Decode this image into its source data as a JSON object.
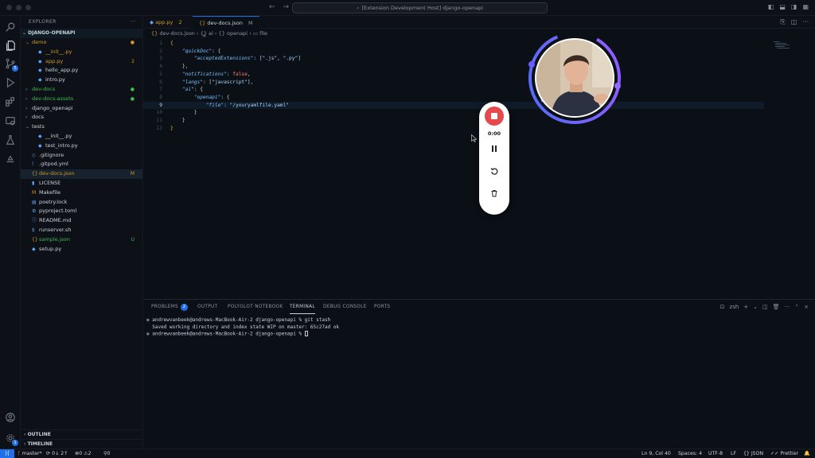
{
  "titlebar": {
    "command_center": "[Extension Development Host] django-openapi"
  },
  "activity_bar": {
    "source_control_badge": "5",
    "accounts_badge": "1"
  },
  "sidebar": {
    "header": "EXPLORER",
    "root": "DJANGO-OPENAPI",
    "items": [
      {
        "label": "demo",
        "status": "",
        "kind": "folder"
      },
      {
        "label": "__init__.py",
        "status": "",
        "kind": "file"
      },
      {
        "label": "app.py",
        "status": "2",
        "kind": "file"
      },
      {
        "label": "hello_app.py",
        "status": "",
        "kind": "file"
      },
      {
        "label": "intro.py",
        "status": "",
        "kind": "file"
      },
      {
        "label": "dev-docs",
        "status": "",
        "kind": "folder"
      },
      {
        "label": "dev-docs-assets",
        "status": "",
        "kind": "folder"
      },
      {
        "label": "django_openapi",
        "status": "",
        "kind": "folder"
      },
      {
        "label": "docs",
        "status": "",
        "kind": "folder"
      },
      {
        "label": "tests",
        "status": "",
        "kind": "folder"
      },
      {
        "label": "__init__.py",
        "status": "",
        "kind": "file"
      },
      {
        "label": "test_intro.py",
        "status": "",
        "kind": "file"
      },
      {
        "label": ".gitignore",
        "status": "",
        "kind": "file"
      },
      {
        "label": ".gitpod.yml",
        "status": "",
        "kind": "file"
      },
      {
        "label": "dev-docs.json",
        "status": "M",
        "kind": "file"
      },
      {
        "label": "LICENSE",
        "status": "",
        "kind": "file"
      },
      {
        "label": "Makefile",
        "status": "",
        "kind": "file"
      },
      {
        "label": "poetry.lock",
        "status": "",
        "kind": "file"
      },
      {
        "label": "pyproject.toml",
        "status": "",
        "kind": "file"
      },
      {
        "label": "README.md",
        "status": "",
        "kind": "file"
      },
      {
        "label": "runserver.sh",
        "status": "",
        "kind": "file"
      },
      {
        "label": "sample.json",
        "status": "U",
        "kind": "file"
      },
      {
        "label": "setup.py",
        "status": "",
        "kind": "file"
      }
    ],
    "outline": "OUTLINE",
    "timeline": "TIMELINE"
  },
  "tabs": [
    {
      "label": "app.py",
      "badge": "2"
    },
    {
      "label": "dev-docs.json",
      "badge": "M"
    }
  ],
  "breadcrumb": {
    "file": "dev-docs.json",
    "seg1": "ai",
    "seg2": "openapi",
    "seg3": "file"
  },
  "code": {
    "line_numbers": [
      "1",
      "2",
      "3",
      "4",
      "5",
      "6",
      "7",
      "8",
      "9",
      "10",
      "11",
      "12"
    ],
    "l1": "{",
    "l2_key": "\"quickDoc\"",
    "l3_key": "\"acceptedExtensions\"",
    "l3_v1": "\".js\"",
    "l3_v2": "\".py\"",
    "l4": "},",
    "l5_key": "\"notifications\"",
    "l5_val": "false",
    "l6_key": "\"langs\"",
    "l6_val": "\"javascript\"",
    "l7_key": "\"ai\"",
    "l8_key": "\"openapi\"",
    "l9_key": "\"file\"",
    "l9_val": "\"/youryamlfile.yaml\"",
    "l10": "}",
    "l11": "}",
    "l12": "}"
  },
  "recorder": {
    "time": "0:00"
  },
  "panel": {
    "tabs": [
      "PROBLEMS",
      "OUTPUT",
      "POLYGLOT NOTEBOOK",
      "TERMINAL",
      "DEBUG CONSOLE",
      "PORTS"
    ],
    "problems_count": "2",
    "shell": "zsh",
    "terminal": [
      "andrewvanbeek@andrews-MacBook-Air-2 django-openapi % git stash",
      "Saved working directory and index state WIP on master: 65c27ad ok",
      "andrewvanbeek@andrews-MacBook-Air-2 django-openapi % "
    ]
  },
  "statusbar": {
    "branch": "master*",
    "sync": "0↓ 2↑",
    "errors": "0",
    "warnings": "2",
    "ports": "0",
    "position": "Ln 9, Col 40",
    "spaces": "Spaces: 4",
    "encoding": "UTF-8",
    "eol": "LF",
    "language": "JSON",
    "formatter": "Prettier"
  },
  "colors": {
    "accent": "#1f6feb",
    "record": "#e5484d",
    "ring": "#7c5cff"
  }
}
